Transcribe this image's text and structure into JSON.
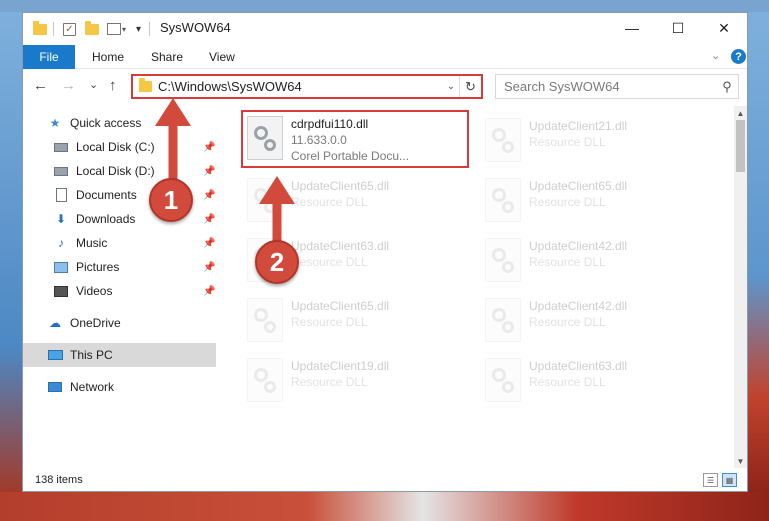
{
  "window": {
    "title": "SysWOW64",
    "controls": {
      "minimize": "—",
      "maximize": "☐",
      "close": "✕"
    }
  },
  "ribbon": {
    "tabs": [
      "File",
      "Home",
      "Share",
      "View"
    ],
    "help": "?"
  },
  "navigation": {
    "back": "←",
    "forward": "→",
    "recent": "⌄",
    "up": "↑",
    "address": "C:\\Windows\\SysWOW64",
    "search_placeholder": "Search SysWOW64"
  },
  "sidebar": {
    "items": [
      {
        "label": "Quick access",
        "icon": "star-icon",
        "pinned": false
      },
      {
        "label": "Local Disk (C:)",
        "icon": "drive-icon",
        "pinned": true
      },
      {
        "label": "Local Disk (D:)",
        "icon": "drive-icon",
        "pinned": true
      },
      {
        "label": "Documents",
        "icon": "documents-icon",
        "pinned": true
      },
      {
        "label": "Downloads",
        "icon": "downloads-icon",
        "pinned": true
      },
      {
        "label": "Music",
        "icon": "music-icon",
        "pinned": true
      },
      {
        "label": "Pictures",
        "icon": "pictures-icon",
        "pinned": true
      },
      {
        "label": "Videos",
        "icon": "videos-icon",
        "pinned": true
      },
      {
        "label": "OneDrive",
        "icon": "cloud-icon",
        "pinned": false
      },
      {
        "label": "This PC",
        "icon": "pc-icon",
        "pinned": false,
        "selected": true
      },
      {
        "label": "Network",
        "icon": "network-icon",
        "pinned": false
      }
    ]
  },
  "files": {
    "highlighted": {
      "name": "cdrpdfui110.dll",
      "version": "11.633.0.0",
      "description": "Corel Portable Docu..."
    },
    "left_column": [
      {
        "name": "UpdateClient65.dll",
        "meta": "Resource DLL"
      },
      {
        "name": "UpdateClient63.dll",
        "meta": "Resource DLL"
      },
      {
        "name": "UpdateClient65.dll",
        "meta": "Resource DLL"
      },
      {
        "name": "UpdateClient19.dll",
        "meta": "Resource DLL"
      }
    ],
    "right_column": [
      {
        "name": "UpdateClient21.dll",
        "meta": "Resource DLL"
      },
      {
        "name": "UpdateClient65.dll",
        "meta": "Resource DLL"
      },
      {
        "name": "UpdateClient42.dll",
        "meta": "Resource DLL"
      },
      {
        "name": "UpdateClient42.dll",
        "meta": "Resource DLL"
      },
      {
        "name": "UpdateClient63.dll",
        "meta": "Resource DLL"
      }
    ]
  },
  "status": {
    "items_count": "138 items"
  },
  "annotations": {
    "step1": "1",
    "step2": "2"
  },
  "colors": {
    "accent": "#1979ca",
    "highlight_border": "#d93b3b",
    "badge": "#d24a3c"
  }
}
